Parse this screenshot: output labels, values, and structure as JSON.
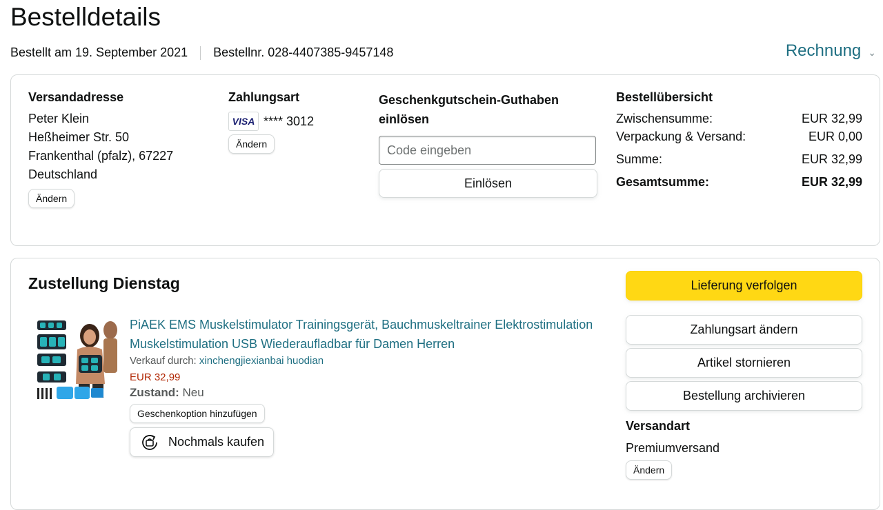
{
  "header": {
    "title": "Bestelldetails",
    "ordered_on": "Bestellt am 19. September 2021",
    "order_number": "Bestellnr. 028-4407385-9457148",
    "invoice_label": "Rechnung"
  },
  "shipping_address": {
    "title": "Versandadresse",
    "lines": [
      "Peter Klein",
      "Heßheimer Str. 50",
      "Frankenthal (pfalz), 67227",
      "Deutschland"
    ],
    "change_label": "Ändern"
  },
  "payment": {
    "title": "Zahlungsart",
    "card_brand": "VISA",
    "card_masked": "**** 3012",
    "change_label": "Ändern"
  },
  "gift_card": {
    "title": "Geschenkgutschein-Guthaben einlösen",
    "input_placeholder": "Code eingeben",
    "redeem_label": "Einlösen"
  },
  "order_summary": {
    "title": "Bestellübersicht",
    "rows": [
      {
        "label": "Zwischensumme:",
        "value": "EUR 32,99"
      },
      {
        "label": "Verpackung & Versand:",
        "value": "EUR 0,00"
      },
      {
        "label": "Summe:",
        "value": "EUR 32,99"
      },
      {
        "label": "Gesamtsumme:",
        "value": "EUR 32,99"
      }
    ]
  },
  "delivery": {
    "title": "Zustellung Dienstag",
    "product": {
      "name": "PiAEK EMS Muskelstimulator Trainingsgerät, Bauchmuskeltrainer Elektrostimulation Muskelstimulation USB Wiederaufladbar für Damen Herren",
      "seller_prefix": "Verkauf durch:",
      "seller_name": "xinchengjiexianbai huodian",
      "price": "EUR 32,99",
      "condition_label": "Zustand:",
      "condition_value": "Neu",
      "gift_option_label": "Geschenkoption hinzufügen",
      "buy_again_label": "Nochmals kaufen"
    },
    "actions": {
      "track": "Lieferung verfolgen",
      "change_payment": "Zahlungsart ändern",
      "cancel": "Artikel stornieren",
      "archive": "Bestellung archivieren"
    },
    "shipping_method": {
      "title": "Versandart",
      "value": "Premiumversand",
      "change_label": "Ändern"
    }
  },
  "colors": {
    "link": "#1f6f82",
    "price": "#b12704",
    "primary_button": "#ffd814",
    "border": "#d5d9d9"
  }
}
